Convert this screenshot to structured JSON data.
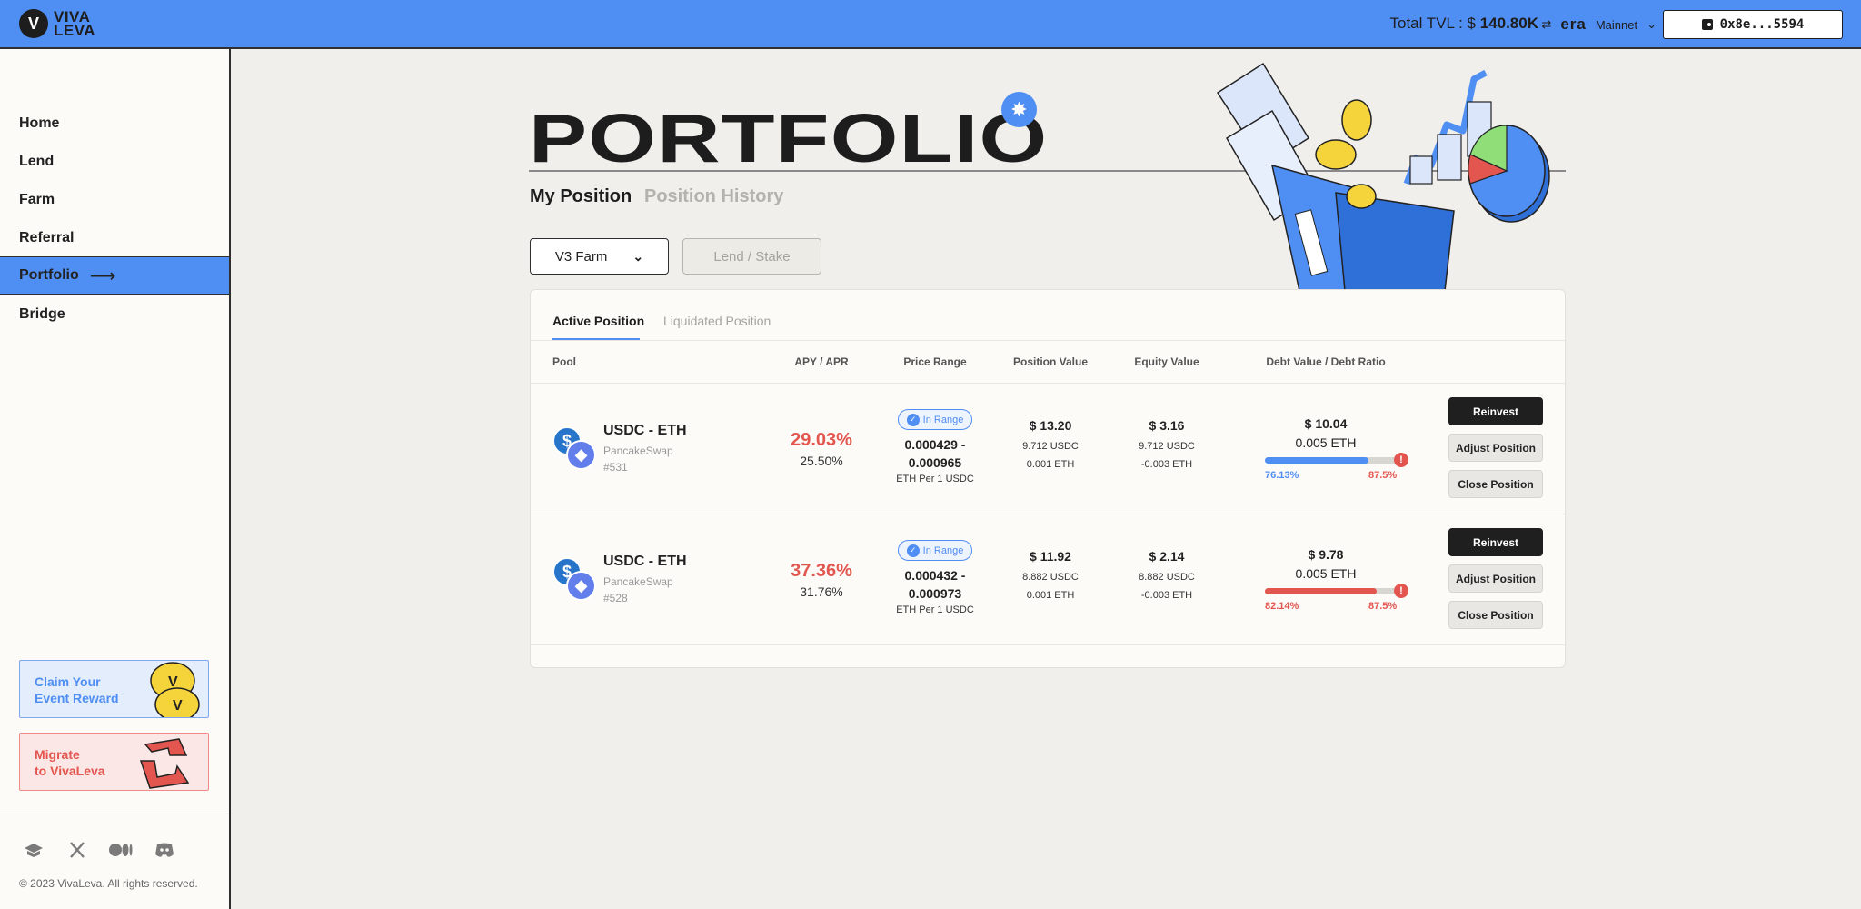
{
  "header": {
    "logo_text_top": "VIVA",
    "logo_text_bottom": "LEVA",
    "tvl_label": "Total TVL : $",
    "tvl_value": "140.80K",
    "network_logo": "era",
    "network": "Mainnet",
    "wallet": "0x8e...5594"
  },
  "sidebar": {
    "items": [
      {
        "label": "Home"
      },
      {
        "label": "Lend"
      },
      {
        "label": "Farm"
      },
      {
        "label": "Referral"
      },
      {
        "label": "Portfolio"
      },
      {
        "label": "Bridge"
      }
    ],
    "active_index": 4,
    "promo_claim_line1": "Claim Your",
    "promo_claim_line2": "Event Reward",
    "promo_migrate_line1": "Migrate",
    "promo_migrate_line2": "to VivaLeva",
    "copyright": "© 2023 VivaLeva. All rights reserved."
  },
  "main": {
    "title": "PORTFOLIO",
    "subtabs": [
      "My Position",
      "Position History"
    ],
    "farm_select": "V3 Farm",
    "lend_button": "Lend / Stake",
    "tabs": [
      "Active Position",
      "Liquidated Position"
    ],
    "columns": [
      "Pool",
      "APY / APR",
      "Price Range",
      "Position Value",
      "Equity Value",
      "Debt Value / Debt Ratio"
    ],
    "rows": [
      {
        "pool": "USDC - ETH",
        "dex": "PancakeSwap",
        "id": "#531",
        "apy": "29.03%",
        "apr": "25.50%",
        "range_status": "In Range",
        "range_low": "0.000429 -",
        "range_high": "0.000965",
        "range_unit": "ETH Per 1 USDC",
        "position_value": "$ 13.20",
        "position_usdc": "9.712 USDC",
        "position_eth": "0.001 ETH",
        "equity_value": "$ 3.16",
        "equity_usdc": "9.712 USDC",
        "equity_eth": "-0.003 ETH",
        "debt_value": "$ 10.04",
        "debt_eth": "0.005 ETH",
        "debt_ratio": "76.13%",
        "debt_ratio_value": 76.13,
        "debt_ratio_max": "87.5%",
        "ratio_color": "#4f8ef3",
        "actions": [
          "Reinvest",
          "Adjust Position",
          "Close Position"
        ]
      },
      {
        "pool": "USDC - ETH",
        "dex": "PancakeSwap",
        "id": "#528",
        "apy": "37.36%",
        "apr": "31.76%",
        "range_status": "In Range",
        "range_low": "0.000432 -",
        "range_high": "0.000973",
        "range_unit": "ETH Per 1 USDC",
        "position_value": "$ 11.92",
        "position_usdc": "8.882 USDC",
        "position_eth": "0.001 ETH",
        "equity_value": "$ 2.14",
        "equity_usdc": "8.882 USDC",
        "equity_eth": "-0.003 ETH",
        "debt_value": "$ 9.78",
        "debt_eth": "0.005 ETH",
        "debt_ratio": "82.14%",
        "debt_ratio_value": 82.14,
        "debt_ratio_max": "87.5%",
        "ratio_color": "#e2564f",
        "actions": [
          "Reinvest",
          "Adjust Position",
          "Close Position"
        ]
      }
    ]
  },
  "colors": {
    "brand_blue": "#4f8ef3",
    "danger_red": "#e2564f",
    "dark": "#1d1d1d"
  }
}
